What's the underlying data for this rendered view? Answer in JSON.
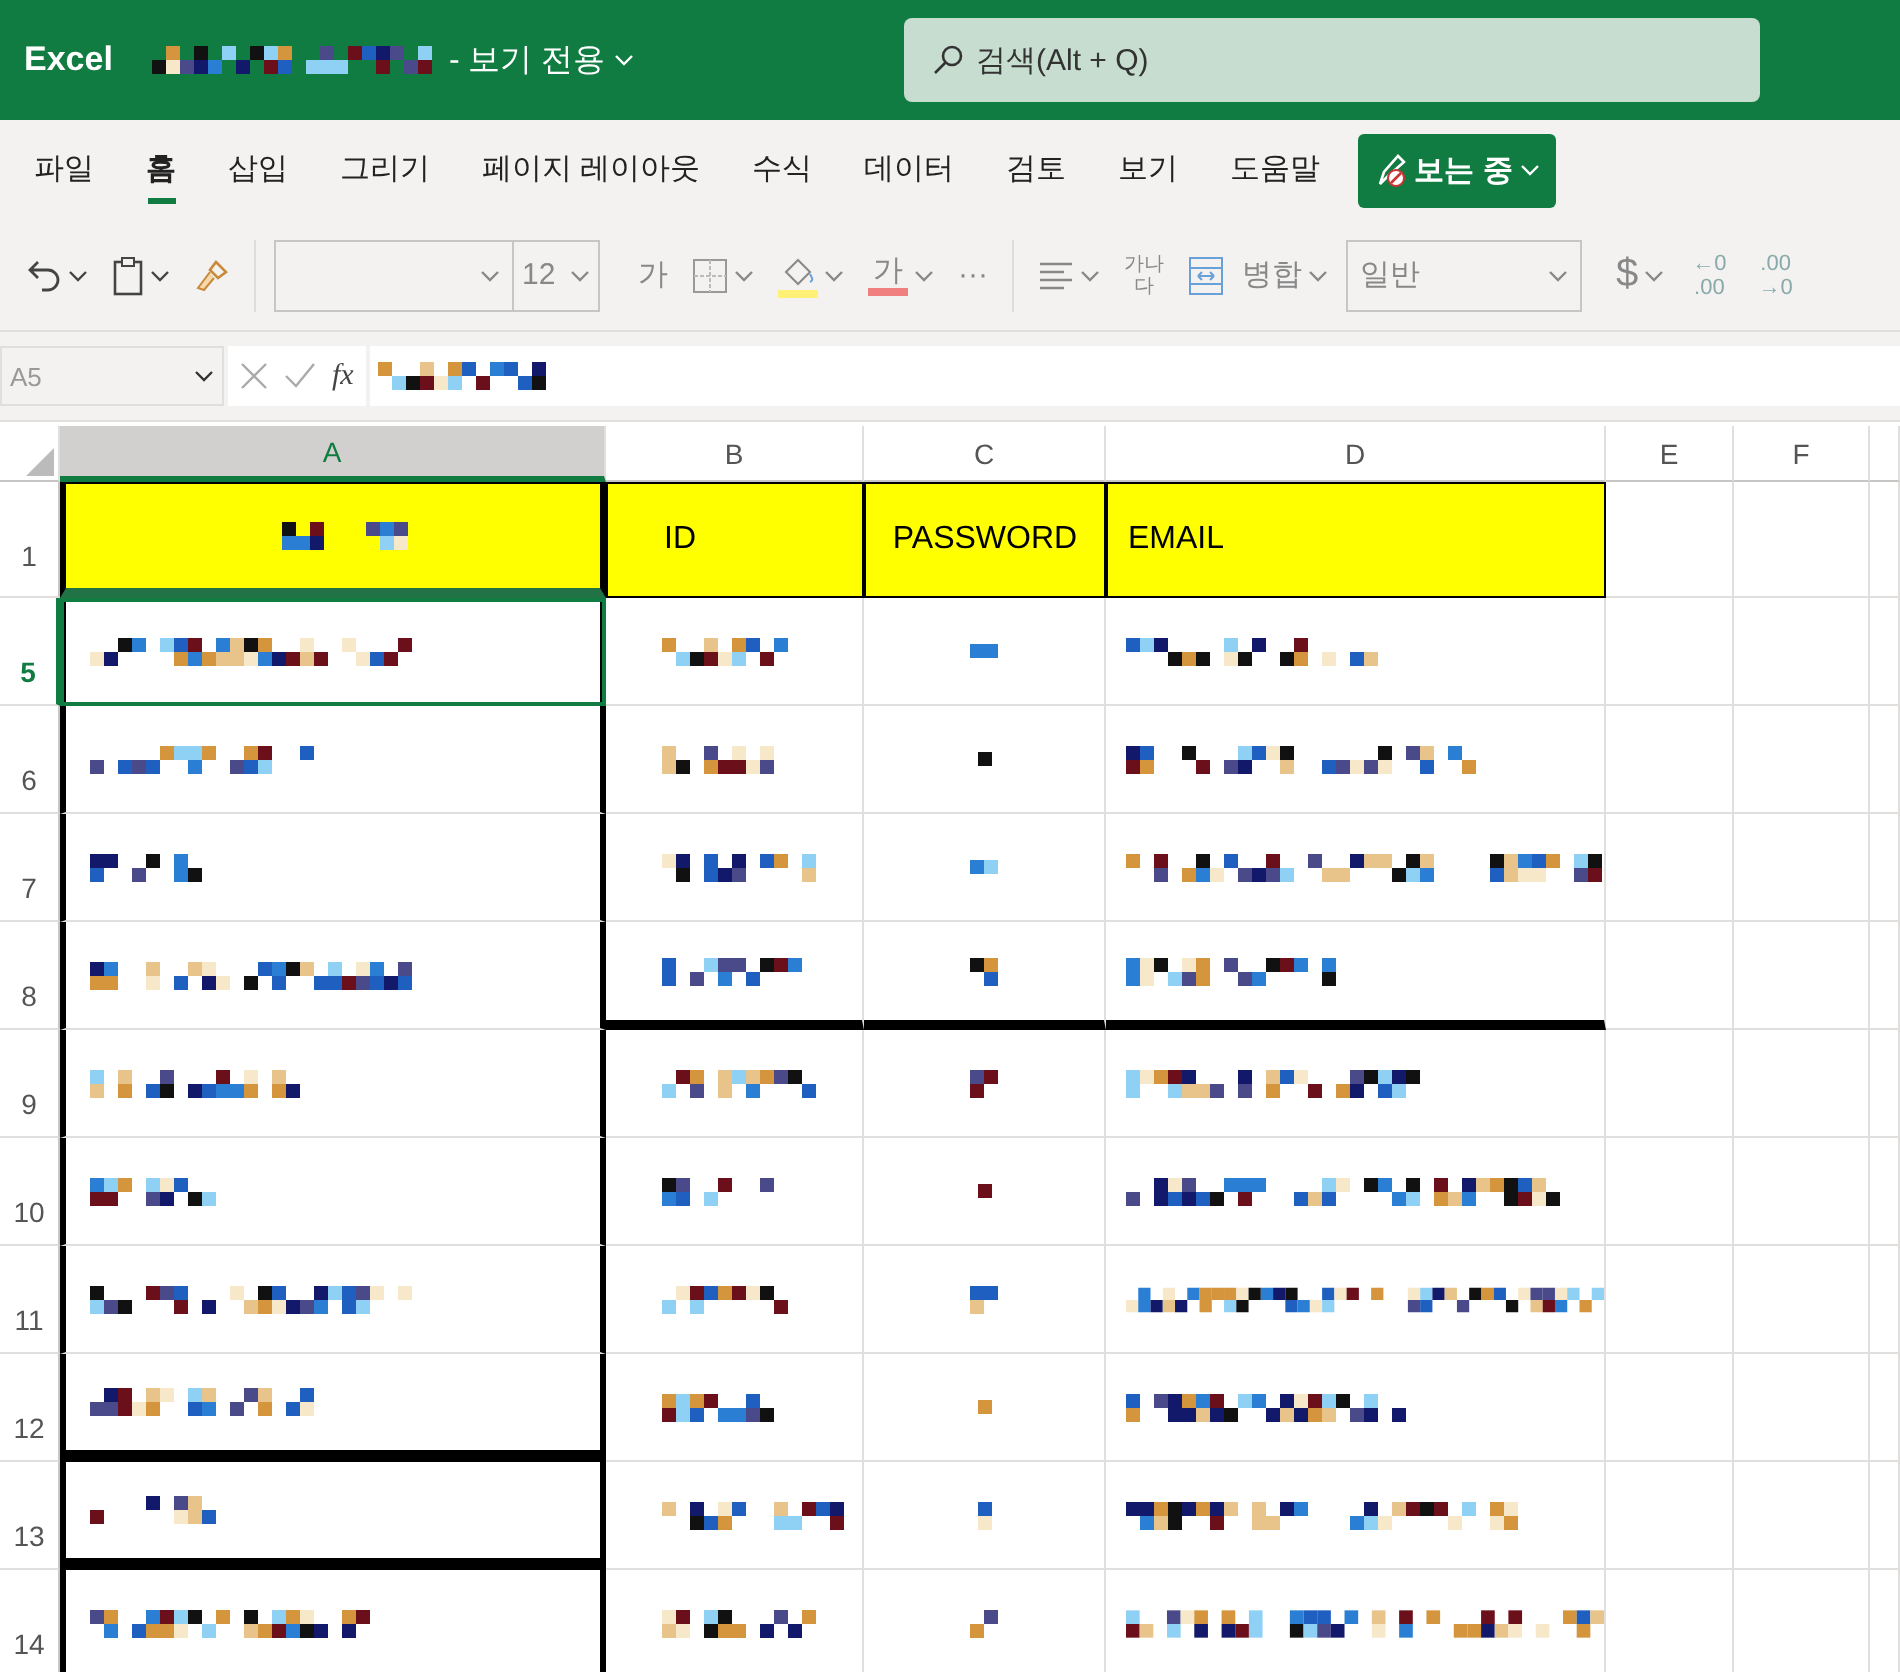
{
  "title_bar": {
    "app": "Excel",
    "file_name": {
      "kind": "pixelated"
    },
    "mode": "- 보기 전용",
    "search": {
      "placeholder": "검색(Alt + Q)"
    }
  },
  "tabs": [
    {
      "label": "파일",
      "selected": false
    },
    {
      "label": "홈",
      "selected": true
    },
    {
      "label": "삽입",
      "selected": false
    },
    {
      "label": "그리기",
      "selected": false
    },
    {
      "label": "페이지 레이아웃",
      "selected": false
    },
    {
      "label": "수식",
      "selected": false
    },
    {
      "label": "데이터",
      "selected": false
    },
    {
      "label": "검토",
      "selected": false
    },
    {
      "label": "보기",
      "selected": false
    },
    {
      "label": "도움말",
      "selected": false
    }
  ],
  "viewing_button": {
    "label": "보는 중"
  },
  "toolbar": {
    "font_size": "12",
    "grow_font": "가",
    "font_color": "가",
    "more": "···",
    "wrap_text": "가나 다",
    "merge": "병합",
    "number_format": "일반",
    "currency": "$",
    "decrease_decimal": [
      "←0",
      ".00"
    ],
    "increase_decimal": [
      ".00",
      "→0"
    ]
  },
  "formula_bar": {
    "name_box": "A5",
    "fx": "fx",
    "content": {
      "kind": "pixelated"
    }
  },
  "columns": [
    {
      "label": "A",
      "selected": true
    },
    {
      "label": "B",
      "selected": false
    },
    {
      "label": "C",
      "selected": false
    },
    {
      "label": "D",
      "selected": false
    },
    {
      "label": "E",
      "selected": false
    },
    {
      "label": "F",
      "selected": false
    }
  ],
  "rows": [
    {
      "number": "1",
      "kind": "header",
      "selected": false,
      "cells": [
        {
          "kind": "pixelated"
        },
        {
          "kind": "text",
          "text": "ID"
        },
        {
          "kind": "text",
          "text": "PASSWORD"
        },
        {
          "kind": "text",
          "text": "EMAIL"
        }
      ]
    },
    {
      "number": "5",
      "kind": "data",
      "selected": true,
      "cells": [
        {
          "kind": "pixelated"
        },
        {
          "kind": "pixelated"
        },
        {
          "kind": "pixelated"
        },
        {
          "kind": "pixelated"
        }
      ]
    },
    {
      "number": "6",
      "kind": "data",
      "selected": false,
      "cells": [
        {
          "kind": "pixelated"
        },
        {
          "kind": "pixelated"
        },
        {
          "kind": "pixelated"
        },
        {
          "kind": "pixelated"
        }
      ]
    },
    {
      "number": "7",
      "kind": "data",
      "selected": false,
      "cells": [
        {
          "kind": "pixelated"
        },
        {
          "kind": "pixelated"
        },
        {
          "kind": "pixelated"
        },
        {
          "kind": "pixelated"
        }
      ]
    },
    {
      "number": "8",
      "kind": "data",
      "selected": false,
      "cells": [
        {
          "kind": "pixelated"
        },
        {
          "kind": "pixelated",
          "thick_bottom": true
        },
        {
          "kind": "pixelated",
          "thick_bottom": true
        },
        {
          "kind": "pixelated",
          "thick_bottom": true
        }
      ]
    },
    {
      "number": "9",
      "kind": "data",
      "selected": false,
      "cells": [
        {
          "kind": "pixelated"
        },
        {
          "kind": "pixelated"
        },
        {
          "kind": "pixelated"
        },
        {
          "kind": "pixelated"
        }
      ]
    },
    {
      "number": "10",
      "kind": "data",
      "selected": false,
      "cells": [
        {
          "kind": "pixelated"
        },
        {
          "kind": "pixelated"
        },
        {
          "kind": "pixelated"
        },
        {
          "kind": "pixelated"
        }
      ]
    },
    {
      "number": "11",
      "kind": "data",
      "selected": false,
      "cells": [
        {
          "kind": "pixelated"
        },
        {
          "kind": "pixelated"
        },
        {
          "kind": "pixelated"
        },
        {
          "kind": "pixelated"
        }
      ]
    },
    {
      "number": "12",
      "kind": "data",
      "selected": false,
      "cells": [
        {
          "kind": "pixelated",
          "thick_bottom": true
        },
        {
          "kind": "pixelated"
        },
        {
          "kind": "pixelated"
        },
        {
          "kind": "pixelated"
        }
      ]
    },
    {
      "number": "13",
      "kind": "data",
      "selected": false,
      "cells": [
        {
          "kind": "pixelated",
          "thick_bottom": true
        },
        {
          "kind": "pixelated"
        },
        {
          "kind": "pixelated"
        },
        {
          "kind": "pixelated"
        }
      ]
    },
    {
      "number": "14",
      "kind": "data",
      "selected": false,
      "cells": [
        {
          "kind": "pixelated"
        },
        {
          "kind": "pixelated"
        },
        {
          "kind": "pixelated"
        },
        {
          "kind": "pixelated"
        }
      ]
    }
  ]
}
